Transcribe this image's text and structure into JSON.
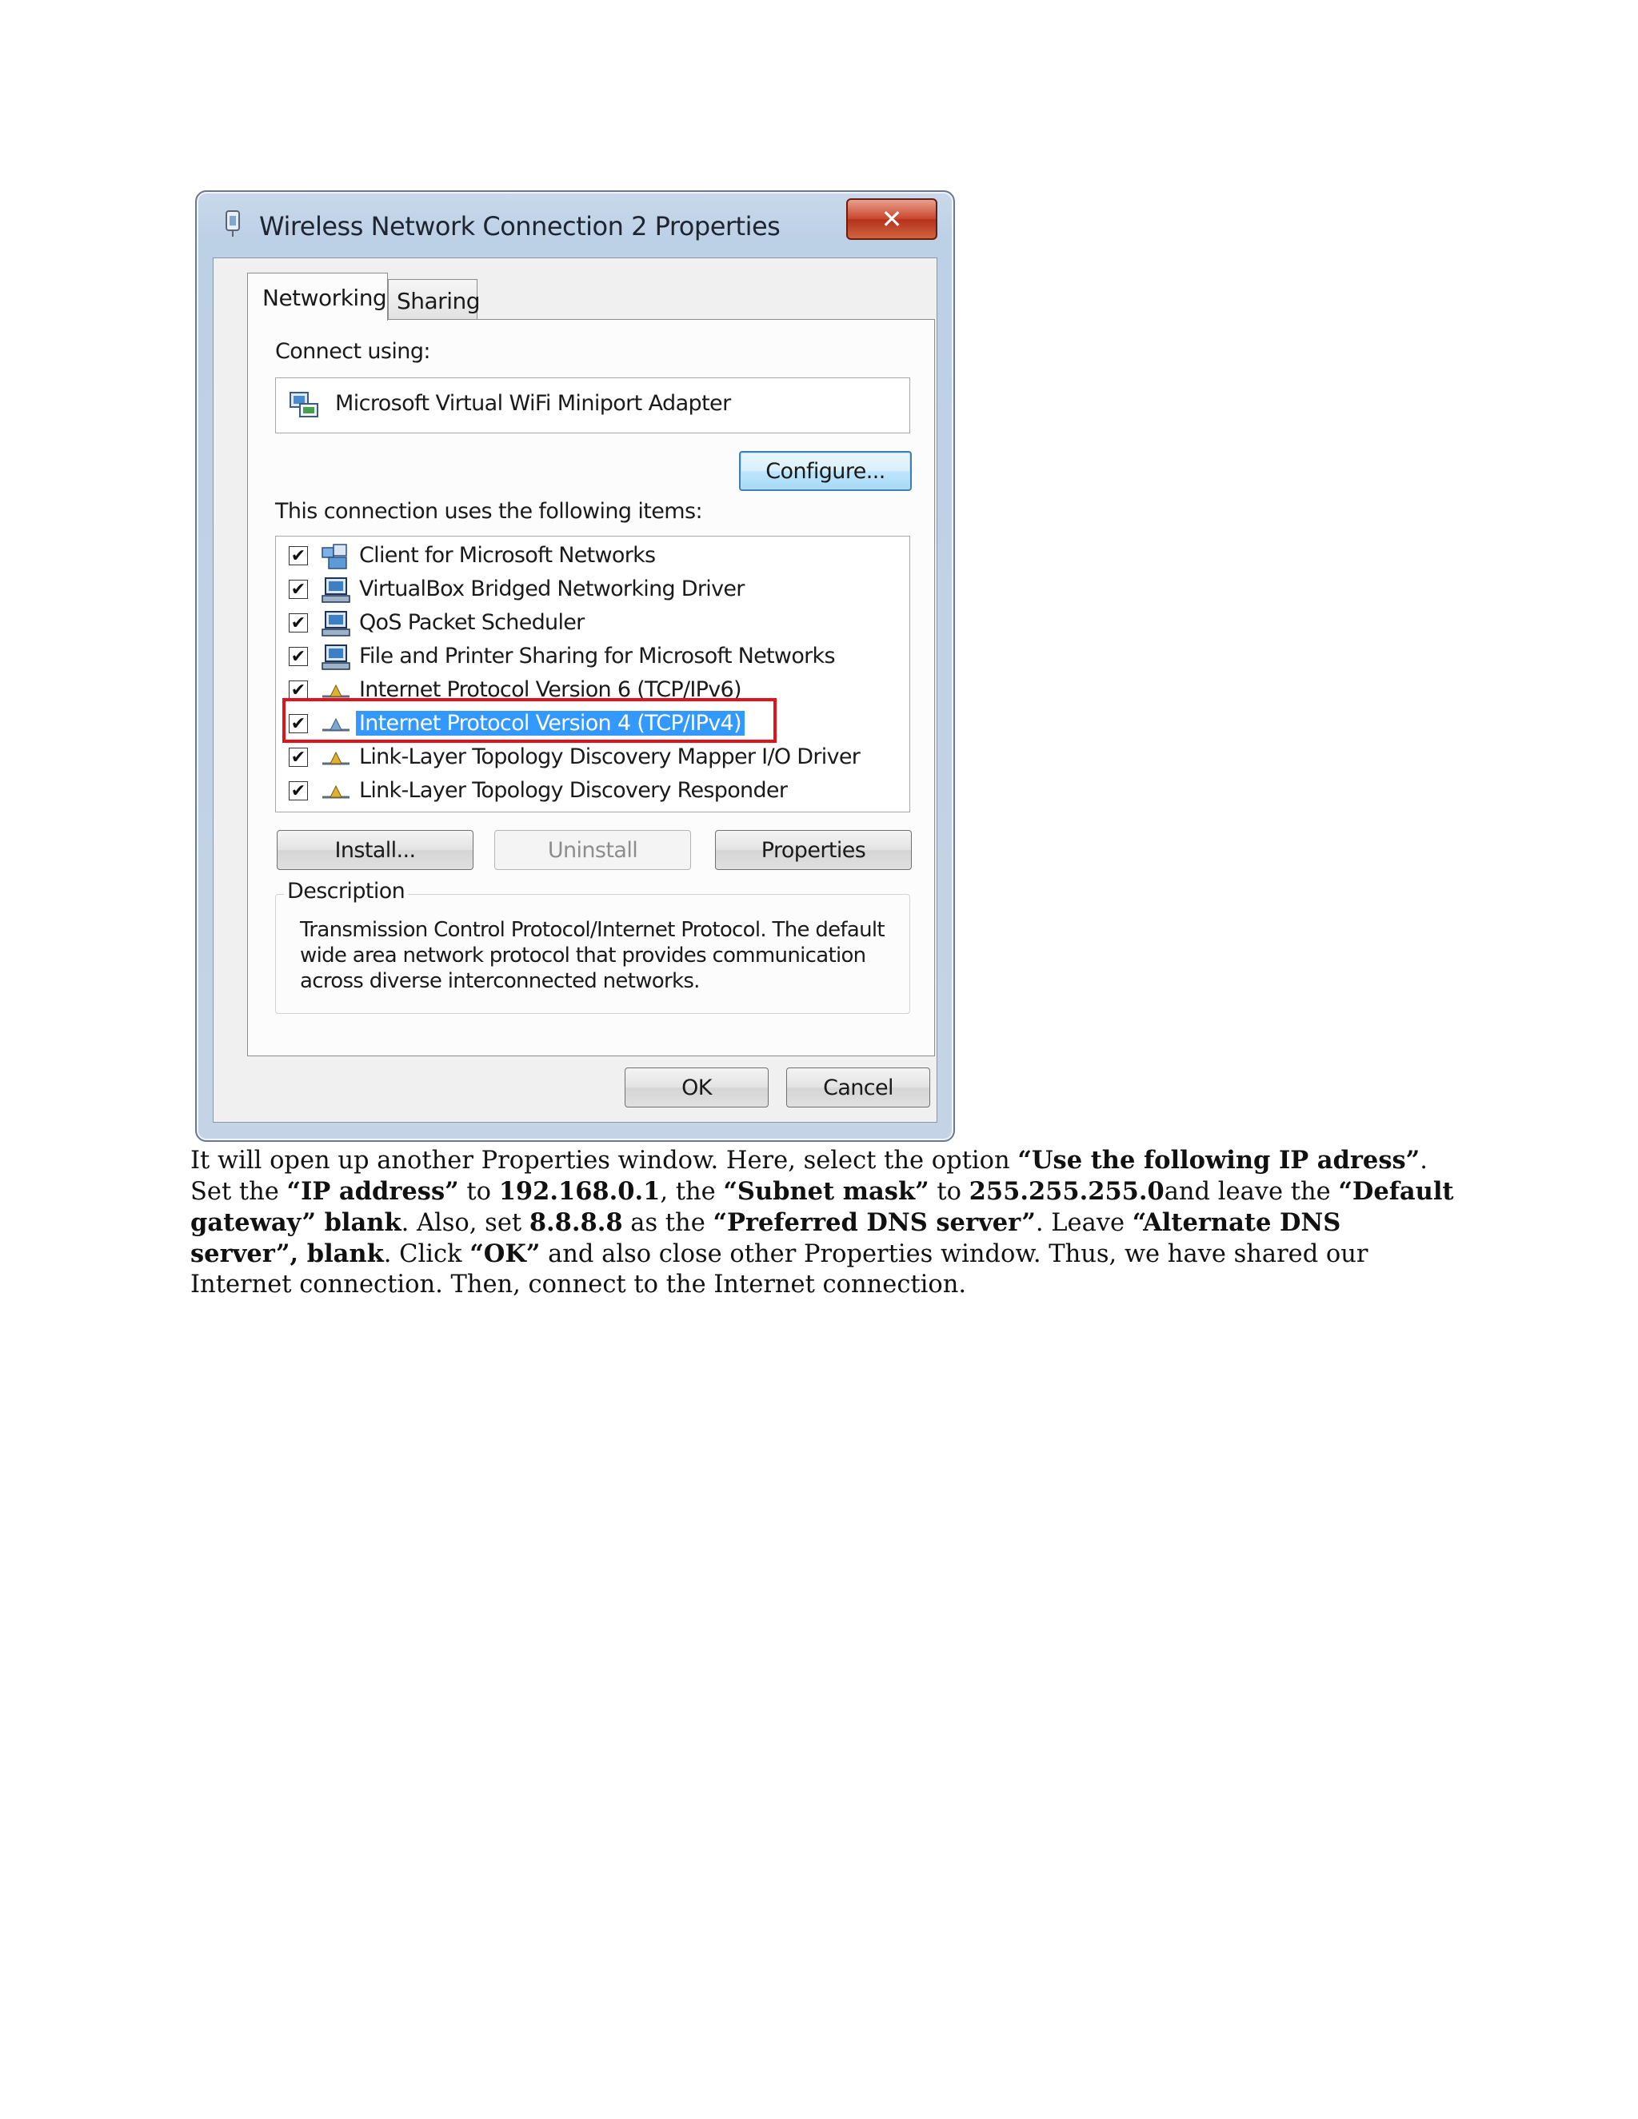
{
  "dialog": {
    "title": "Wireless Network Connection 2 Properties",
    "close_label": "✕",
    "tabs": [
      {
        "label": "Networking",
        "active": true
      },
      {
        "label": "Sharing",
        "active": false
      }
    ],
    "connect_using_label": "Connect using:",
    "adapter_name": "Microsoft Virtual WiFi Miniport Adapter",
    "configure_label": "Configure...",
    "items_label": "This connection uses the following items:",
    "items": [
      {
        "label": "Client for Microsoft Networks",
        "checked": true,
        "icon": "network-client-icon"
      },
      {
        "label": "VirtualBox Bridged Networking Driver",
        "checked": true,
        "icon": "network-service-icon"
      },
      {
        "label": "QoS Packet Scheduler",
        "checked": true,
        "icon": "network-service-icon"
      },
      {
        "label": "File and Printer Sharing for Microsoft Networks",
        "checked": true,
        "icon": "network-service-icon"
      },
      {
        "label": "Internet Protocol Version 6 (TCP/IPv6)",
        "checked": true,
        "icon": "protocol-icon"
      },
      {
        "label": "Internet Protocol Version 4 (TCP/IPv4)",
        "checked": true,
        "icon": "protocol-icon",
        "selected": true
      },
      {
        "label": "Link-Layer Topology Discovery Mapper I/O Driver",
        "checked": true,
        "icon": "protocol-icon"
      },
      {
        "label": "Link-Layer Topology Discovery Responder",
        "checked": true,
        "icon": "protocol-icon"
      }
    ],
    "install_label": "Install...",
    "uninstall_label": "Uninstall",
    "properties_label": "Properties",
    "description_legend": "Description",
    "description_text": "Transmission Control Protocol/Internet Protocol. The default wide area network protocol that provides communication across diverse interconnected networks.",
    "ok_label": "OK",
    "cancel_label": "Cancel",
    "highlight_color": "#e0131d",
    "selection_color": "#3399ff"
  },
  "document": {
    "p1": "It will open up another Properties window. Here, select the option ",
    "b1": "“Use the following IP adress”",
    "p2": ". Set the ",
    "b2": "“IP address”",
    "p3": " to ",
    "b3": "192.168.0.1",
    "p4": ", the ",
    "b4": "“Subnet mask”",
    "p5": " to ",
    "b5": "255.255.255.0",
    "p6": "and leave the ",
    "b6": "“Default gateway” blank",
    "p7": ". Also, set ",
    "b7": "8.8.8.8",
    "p8": " as the ",
    "b8": "“Preferred DNS server”",
    "p9": ". Leave ",
    "b9": "“Alternate DNS server”, blank",
    "p10": ". Click ",
    "b10": "“OK”",
    "p11": " and also close other Properties window. Thus, we have shared our Internet connection. Then, connect to the Internet connection."
  }
}
